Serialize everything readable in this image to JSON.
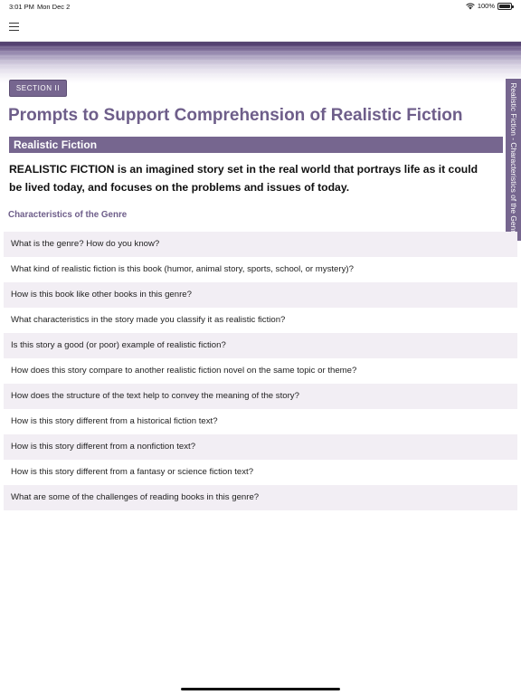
{
  "status_bar": {
    "time": "3:01 PM",
    "date": "Mon Dec 2",
    "battery": "100%"
  },
  "section": {
    "tag": "SECTION II"
  },
  "page": {
    "title": "Prompts to Support Comprehension of Realistic Fiction",
    "subtitle": "Realistic Fiction",
    "intro": "REALISTIC FICTION is an imagined story set in the real world that portrays life as it could be lived today, and focuses on the problems and issues of today.",
    "characteristics_heading": "Characteristics of the Genre",
    "side_tab": "Realistic Fiction - Characteristics of the Genre"
  },
  "prompts": [
    "What is the genre? How do you know?",
    "What kind of realistic fiction is this book (humor, animal story, sports, school, or mystery)?",
    "How is this book like other books in this genre?",
    "What characteristics in the story made you classify it as realistic fiction?",
    "Is this story a good (or poor) example of realistic fiction?",
    "How does this story compare to another realistic fiction novel on the same topic or theme?",
    "How does the structure of the text help to convey the meaning of the story?",
    "How is this story different from a historical fiction text?",
    "How is this story different from a nonfiction text?",
    "How is this story different from a fantasy or science fiction text?",
    "What are some of the challenges of reading books in this genre?"
  ],
  "colors": {
    "accent": "#76668f",
    "title": "#6e5e8a",
    "row_shade": "#f2eef4"
  },
  "icons": {
    "menu": "hamburger-menu-icon",
    "wifi": "wifi-icon",
    "battery": "battery-icon"
  }
}
